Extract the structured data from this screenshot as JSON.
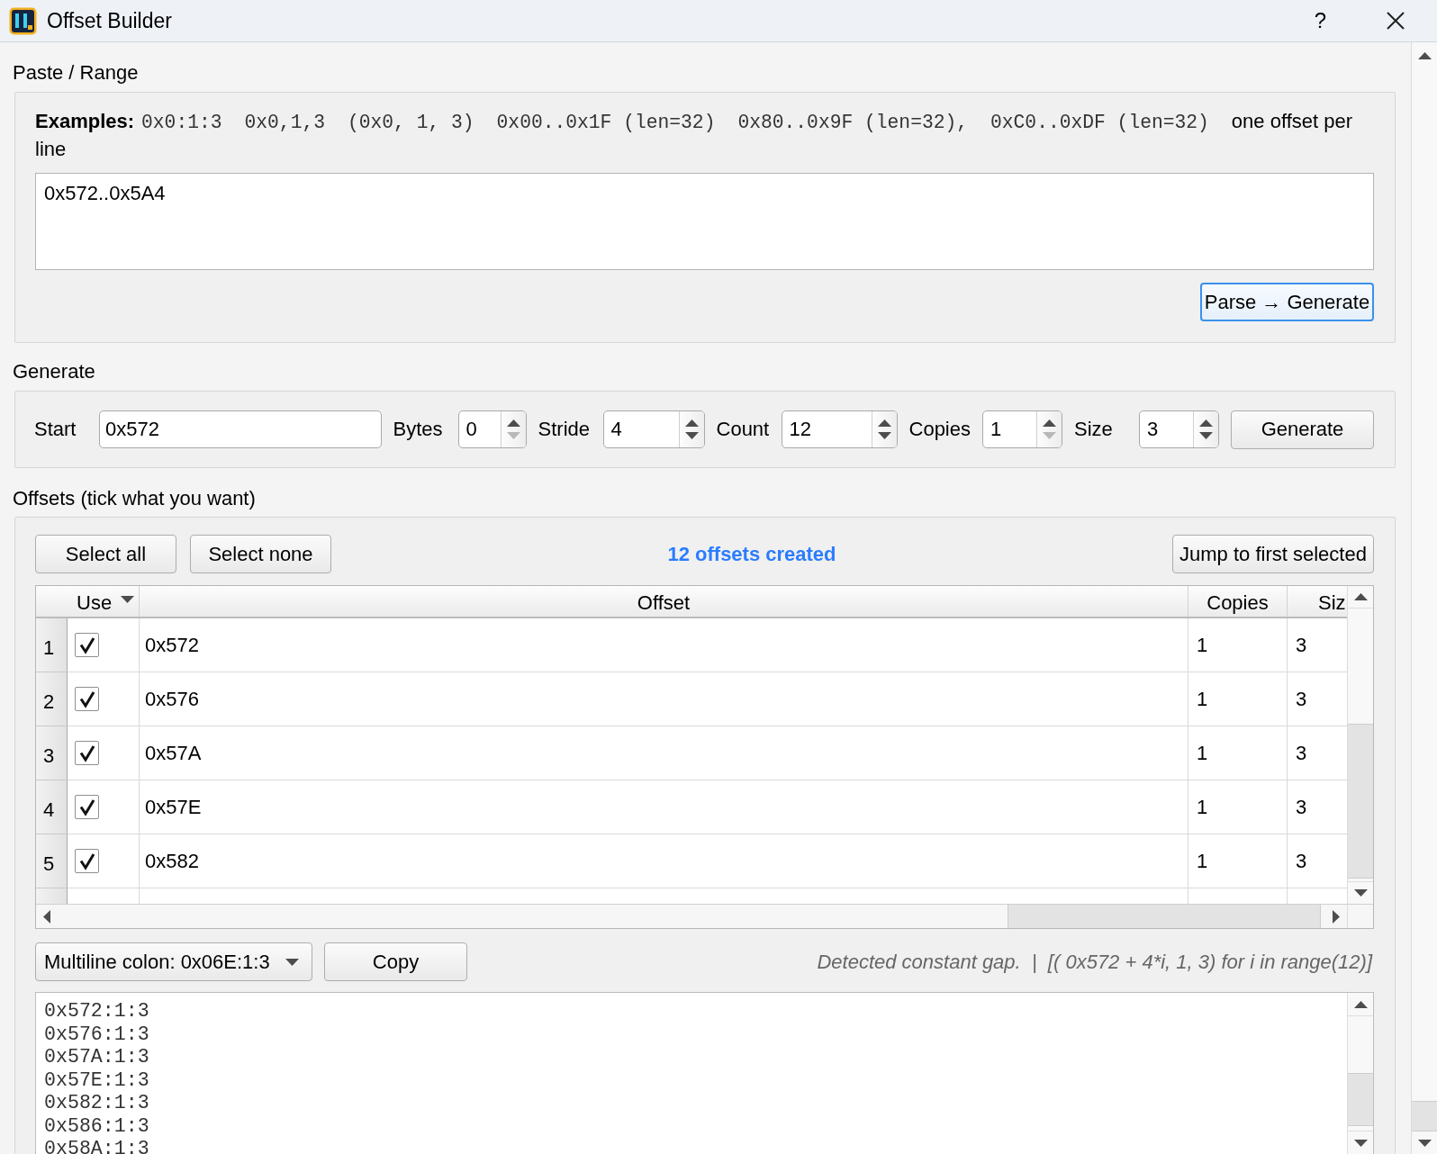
{
  "window": {
    "title": "Offset Builder",
    "help_button": "?"
  },
  "paste_range": {
    "label": "Paste / Range",
    "examples_label": "Examples:",
    "examples": [
      "0x0:1:3",
      "0x0,1,3",
      "(0x0, 1, 3)",
      "0x00..0x1F (len=32)",
      "0x80..0x9F (len=32),",
      "0xC0..0xDF (len=32)"
    ],
    "hint": "one offset per line",
    "input": {
      "value": "0x572..0x5A4"
    },
    "parse_button": {
      "label": "Parse → Generate",
      "focused": true
    }
  },
  "generate": {
    "label": "Generate",
    "fields": [
      {
        "kind": "text",
        "label": "Start",
        "value": "0x572"
      },
      {
        "kind": "spin",
        "label": "Bytes",
        "value": "0",
        "decrement_disabled": true
      },
      {
        "kind": "spin",
        "label": "Stride",
        "value": "4",
        "decrement_disabled": false
      },
      {
        "kind": "spin",
        "label": "Count",
        "value": "12",
        "decrement_disabled": false
      },
      {
        "kind": "spin",
        "label": "Copies",
        "value": "1",
        "decrement_disabled": true
      },
      {
        "kind": "spin",
        "label": "Size",
        "value": "3",
        "decrement_disabled": false
      }
    ],
    "button": "Generate"
  },
  "offsets": {
    "label": "Offsets (tick what you want)",
    "select_all_button": "Select all",
    "select_none_button": "Select none",
    "status": "12 offsets created",
    "jump_button": "Jump to first selected",
    "table": {
      "columns": [
        {
          "label": "Use",
          "sorted": true
        },
        {
          "label": "Offset",
          "sorted": false
        },
        {
          "label": "Copies",
          "sorted": false
        },
        {
          "label": "Siz",
          "sorted": false
        }
      ],
      "rows": [
        {
          "number": "1",
          "checked": true,
          "offset": "0x572",
          "copies": "1",
          "size": "3"
        },
        {
          "number": "2",
          "checked": true,
          "offset": "0x576",
          "copies": "1",
          "size": "3"
        },
        {
          "number": "3",
          "checked": true,
          "offset": "0x57A",
          "copies": "1",
          "size": "3"
        },
        {
          "number": "4",
          "checked": true,
          "offset": "0x57E",
          "copies": "1",
          "size": "3"
        },
        {
          "number": "5",
          "checked": true,
          "offset": "0x582",
          "copies": "1",
          "size": "3"
        }
      ]
    },
    "format": {
      "value": "Multiline colon: 0x06E:1:3"
    },
    "copy_button": "Copy",
    "detection": "Detected constant gap.  |  [( 0x572 + 4*i, 1, 3) for i in range(12)]",
    "output": {
      "value": "0x572:1:3\n0x576:1:3\n0x57A:1:3\n0x57E:1:3\n0x582:1:3\n0x586:1:3\n0x58A:1:3"
    }
  }
}
